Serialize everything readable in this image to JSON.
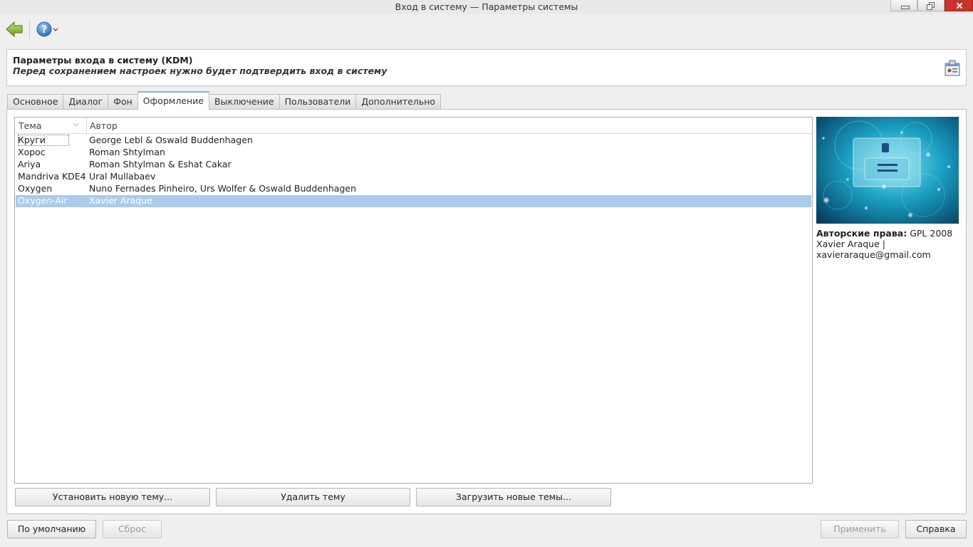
{
  "window": {
    "title": "Вход в систему — Параметры системы"
  },
  "toolbar": {
    "back_icon": "back-arrow-icon",
    "help_icon": "help-icon"
  },
  "header": {
    "title": "Параметры входа в систему (KDM)",
    "subtitle": "Перед сохранением настроек нужно будет подтвердить вход в систему",
    "icon": "kdm-login-icon"
  },
  "tabs": [
    "Основное",
    "Диалог",
    "Фон",
    "Оформление",
    "Выключение",
    "Пользователи",
    "Дополнительно"
  ],
  "active_tab": "Оформление",
  "themes": {
    "columns": {
      "theme": "Тема",
      "author": "Автор"
    },
    "rows": [
      {
        "theme": "Круги",
        "author": "George Lebl & Oswald Buddenhagen"
      },
      {
        "theme": "Хорос",
        "author": "Roman Shtylman"
      },
      {
        "theme": "Ariya",
        "author": "Roman Shtylman & Eshat Cakar"
      },
      {
        "theme": "Mandriva KDE4",
        "author": "Ural Mullabaev"
      },
      {
        "theme": "Oxygen",
        "author": "Nuno Fernades Pinheiro, Urs Wolfer & Oswald Buddenhagen"
      },
      {
        "theme": "Oxygen-Air",
        "author": "Xavier Araque"
      }
    ],
    "selected": "Oxygen-Air"
  },
  "preview_info": {
    "copyright_label": "Авторские права:",
    "copyright_value": "GPL 2008",
    "line2": "Xavier Araque |",
    "line3": "xavieraraque@gmail.com"
  },
  "buttons": {
    "install": "Установить новую тему...",
    "remove": "Удалить тему",
    "download": "Загрузить новые темы...",
    "defaults": "По умолчанию",
    "reset": "Сброс",
    "apply": "Применить",
    "help": "Справка"
  },
  "colors": {
    "selection": "#aacbea",
    "accent": "#86b6e2"
  }
}
